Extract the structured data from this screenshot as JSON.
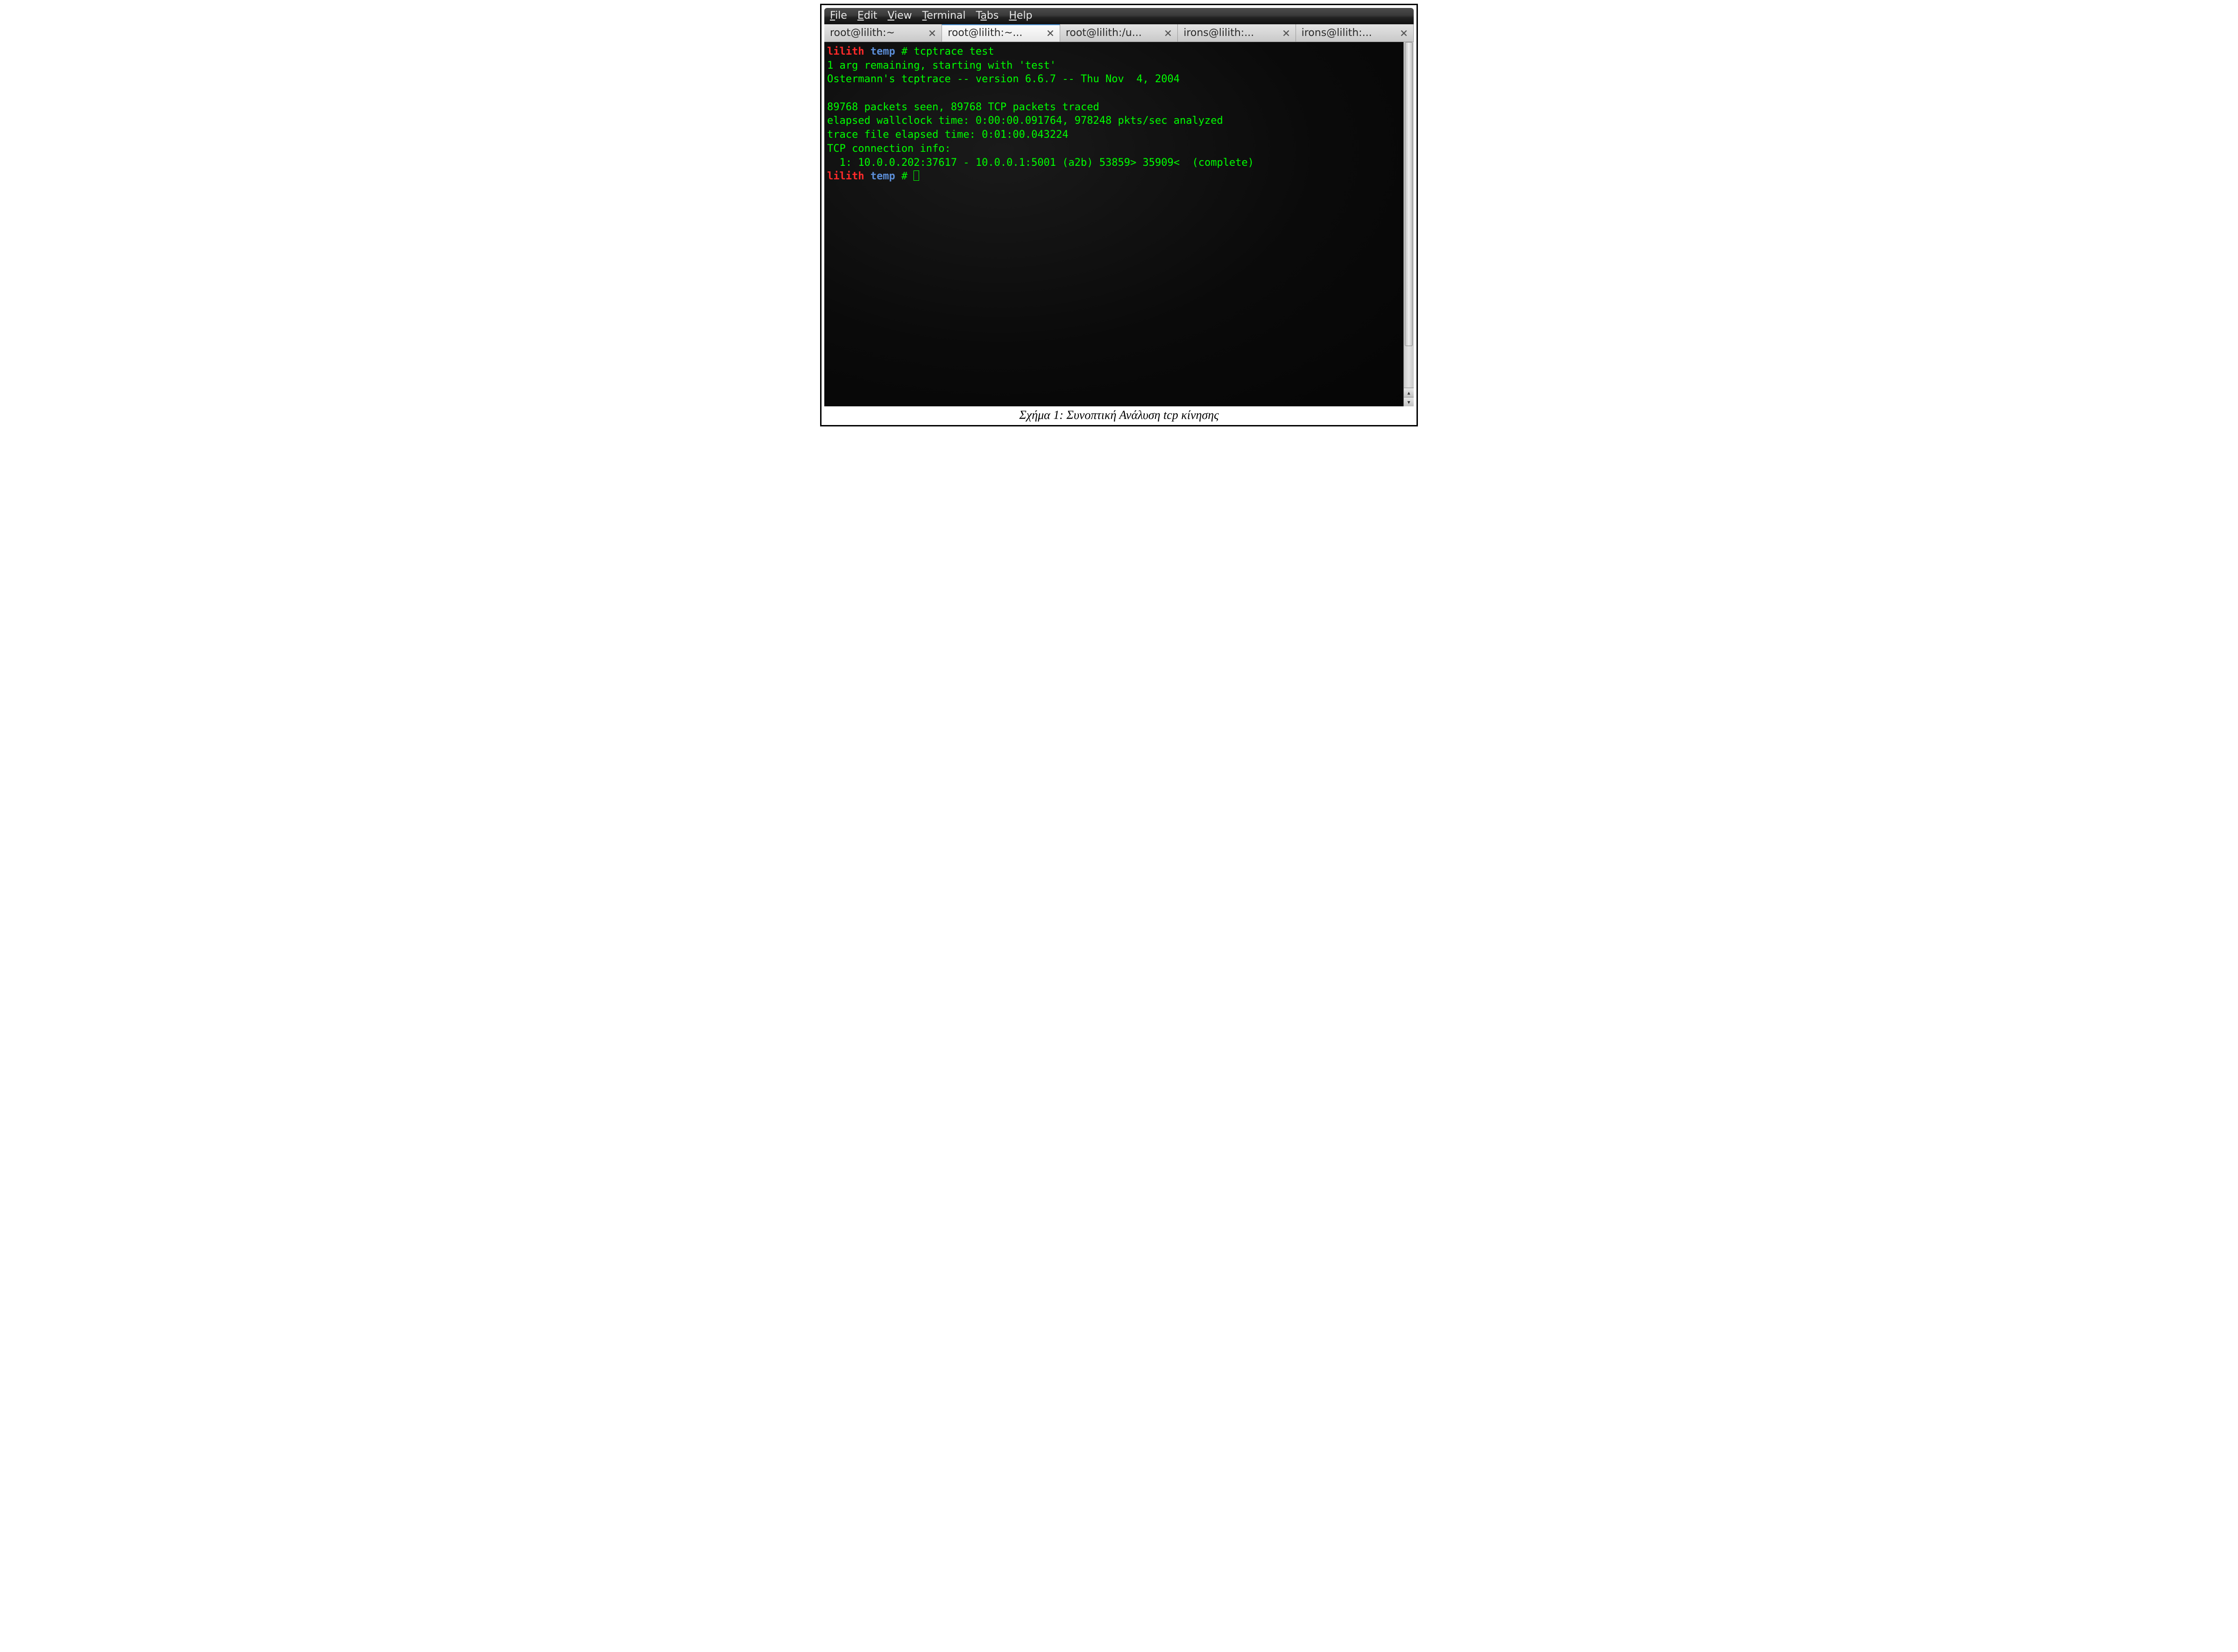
{
  "menu": {
    "items": [
      {
        "label": "File",
        "accel": 0
      },
      {
        "label": "Edit",
        "accel": 0
      },
      {
        "label": "View",
        "accel": 0
      },
      {
        "label": "Terminal",
        "accel": 0
      },
      {
        "label": "Tabs",
        "accel": 1
      },
      {
        "label": "Help",
        "accel": 0
      }
    ]
  },
  "tabs": [
    {
      "label": "root@lilith:~",
      "active": false
    },
    {
      "label": "root@lilith:~...",
      "active": true
    },
    {
      "label": "root@lilith:/u...",
      "active": false
    },
    {
      "label": "irons@lilith:...",
      "active": false
    },
    {
      "label": "irons@lilith:...",
      "active": false
    }
  ],
  "prompt": {
    "host": "lilith",
    "dir": "temp",
    "sep": "#"
  },
  "command": "tcptrace test",
  "output_lines": [
    "1 arg remaining, starting with 'test'",
    "Ostermann's tcptrace -- version 6.6.7 -- Thu Nov  4, 2004",
    "",
    "89768 packets seen, 89768 TCP packets traced",
    "elapsed wallclock time: 0:00:00.091764, 978248 pkts/sec analyzed",
    "trace file elapsed time: 0:01:00.043224",
    "TCP connection info:",
    "  1: 10.0.0.202:37617 - 10.0.0.1:5001 (a2b) 53859> 35909<  (complete)"
  ],
  "scroll": {
    "thumb_top_pct": 0,
    "thumb_height_pct": 88
  },
  "caption": "Σχήμα 1: Συνοπτική Ανάλυση tcp κίνησης",
  "colors": {
    "term_host": "#ff2a2a",
    "term_dir": "#5b8dd6",
    "term_fg": "#00ff00",
    "term_bg": "#0a0a0a"
  }
}
